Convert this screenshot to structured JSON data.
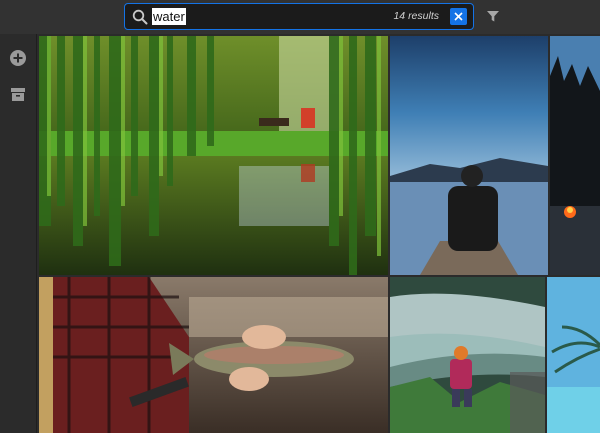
{
  "search": {
    "value": "water",
    "results": "14 results"
  },
  "icons": {
    "search": "search-icon",
    "clear": "close-icon",
    "filter": "filter-icon",
    "add": "plus-circle-icon",
    "archive": "archive-icon"
  },
  "photos": [
    {
      "subject": "willow-tree-pond"
    },
    {
      "subject": "canoe-lake-dusk"
    },
    {
      "subject": "campfire-lakeshore"
    },
    {
      "subject": "trout-in-hands"
    },
    {
      "subject": "hiker-by-river"
    },
    {
      "subject": "palm-beach"
    }
  ],
  "colors": {
    "accent": "#1473e6",
    "background": "#2b2b2b",
    "topbar": "#323232"
  }
}
